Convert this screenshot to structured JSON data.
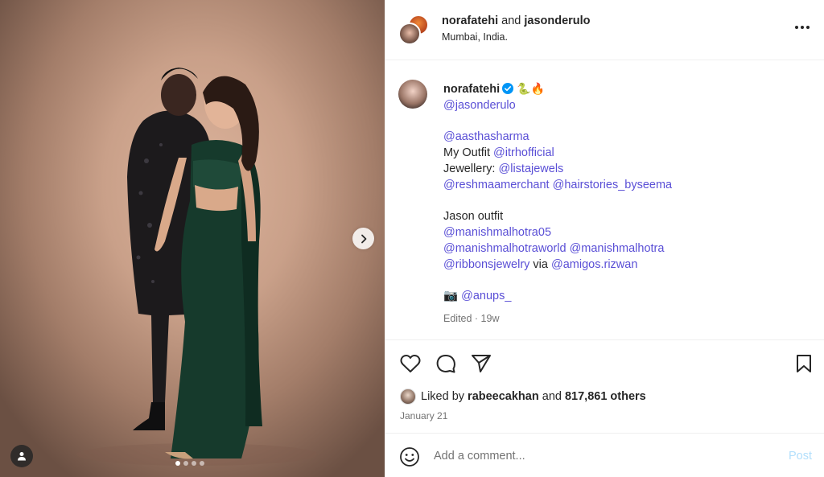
{
  "photo": {
    "alt_icons": {
      "next": "chevron-right-icon",
      "tag": "user-tag-icon"
    },
    "carousel": {
      "count": 4,
      "active": 0
    }
  },
  "header": {
    "user1": "norafatehi",
    "joiner": "and",
    "user2": "jasonderulo",
    "location": "Mumbai, India.",
    "more_icon": "more-horizontal-icon"
  },
  "caption": {
    "username": "norafatehi",
    "name_emojis": "🐍🔥",
    "lines": [
      {
        "prefix": "",
        "mentions": [
          "@jasonderulo"
        ]
      },
      {
        "blank": true
      },
      {
        "prefix": "",
        "mentions": [
          "@aasthasharma"
        ]
      },
      {
        "prefix": "My Outfit ",
        "mentions": [
          "@itrhofficial"
        ]
      },
      {
        "prefix": "Jewellery: ",
        "mentions": [
          "@listajewels"
        ]
      },
      {
        "prefix": "",
        "mentions": [
          "@reshmaamerchant",
          "@hairstories_byseema"
        ]
      },
      {
        "blank": true
      },
      {
        "prefix": "Jason outfit",
        "mentions": []
      },
      {
        "prefix": "",
        "mentions": [
          "@manishmalhotra05"
        ]
      },
      {
        "prefix": "",
        "mentions": [
          "@manishmalhotraworld",
          "@manishmalhotra"
        ]
      },
      {
        "prefix": "",
        "mentions": [
          "@ribbonsjewelry"
        ],
        "middle": " via ",
        "mentions2": [
          "@amigos.rizwan"
        ]
      },
      {
        "blank": true
      },
      {
        "prefix": "📷 ",
        "mentions": [
          "@anups_"
        ]
      }
    ],
    "meta": "Edited · 19w"
  },
  "actions": {
    "like_icon": "heart-icon",
    "comment_icon": "comment-icon",
    "share_icon": "send-icon",
    "save_icon": "bookmark-icon",
    "liked_by_prefix": "Liked by",
    "liked_by_user": "rabeecakhan",
    "liked_by_joiner": "and",
    "liked_by_count": "817,861 others",
    "date": "January 21"
  },
  "comment": {
    "placeholder": "Add a comment...",
    "post_label": "Post",
    "emoji_icon": "smiley-icon"
  },
  "colors": {
    "mention": "#5a4fd6",
    "verified": "#0095f6",
    "post_disabled": "#b2dffc"
  }
}
